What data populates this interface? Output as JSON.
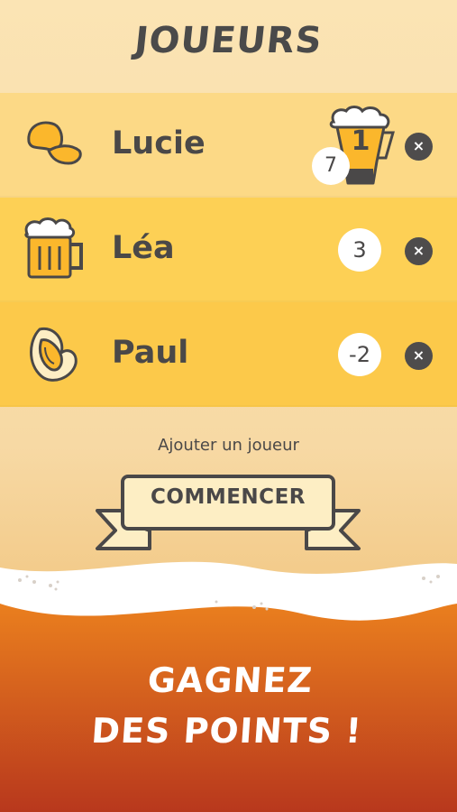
{
  "header": {
    "title": "JOUEURS"
  },
  "players": [
    {
      "name": "Lucie",
      "score": "7",
      "rank": "1",
      "icon": "chip-icon",
      "leader": true
    },
    {
      "name": "Léa",
      "score": "3",
      "icon": "beer-mug-icon",
      "leader": false
    },
    {
      "name": "Paul",
      "score": "-2",
      "icon": "pistachio-icon",
      "leader": false
    }
  ],
  "remove_label": "×",
  "actions": {
    "add_player": "Ajouter un joueur",
    "start": "COMMENCER"
  },
  "footer": {
    "slogan_line1": "GAGNEZ",
    "slogan_line2": "DES POINTS !"
  },
  "colors": {
    "background": "#fbe4b4",
    "row_light": "#fcd986",
    "row_mid": "#fdd055",
    "row_dark": "#fcc94a",
    "ink": "#4a4848",
    "beer_top": "#ea7f1e",
    "beer_bottom": "#b8381d"
  }
}
